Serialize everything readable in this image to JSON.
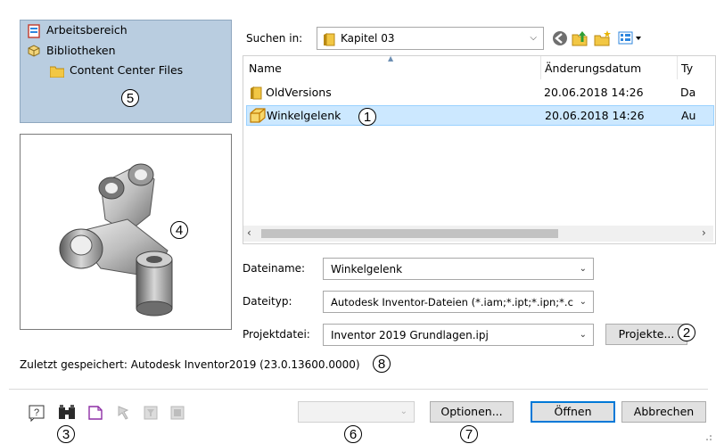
{
  "sidebar": {
    "items": [
      {
        "label": "Arbeitsbereich"
      },
      {
        "label": "Bibliotheken"
      },
      {
        "label": "Content Center Files"
      }
    ]
  },
  "lookin": {
    "label": "Suchen in:",
    "value": "Kapitel 03"
  },
  "filelist": {
    "columns": [
      "Name",
      "Änderungsdatum",
      "Ty"
    ],
    "rows": [
      {
        "name": "OldVersions",
        "date": "20.06.2018 14:26",
        "type": "Da"
      },
      {
        "name": "Winkelgelenk",
        "date": "20.06.2018 14:26",
        "type": "Au"
      }
    ]
  },
  "form": {
    "filename_label": "Dateiname:",
    "filename_value": "Winkelgelenk",
    "filetype_label": "Dateityp:",
    "filetype_value": "Autodesk Inventor-Dateien (*.iam;*.ipt;*.ipn;*.c",
    "project_label": "Projektdatei:",
    "project_value": "Inventor 2019 Grundlagen.ipj",
    "projects_button": "Projekte..."
  },
  "status": {
    "last_saved": "Zuletzt gespeichert: Autodesk Inventor2019 (23.0.13600.0000)"
  },
  "buttons": {
    "options": "Optionen...",
    "open": "Öffnen",
    "cancel": "Abbrechen"
  },
  "callouts": {
    "c1": "1",
    "c2": "2",
    "c3": "3",
    "c4": "4",
    "c5": "5",
    "c6": "6",
    "c7": "7",
    "c8": "8"
  },
  "colors": {
    "sidebar_bg": "#b9cde0",
    "selection_bg": "#cce8ff",
    "selection_border": "#99d1ff",
    "accent": "#0078d7"
  }
}
